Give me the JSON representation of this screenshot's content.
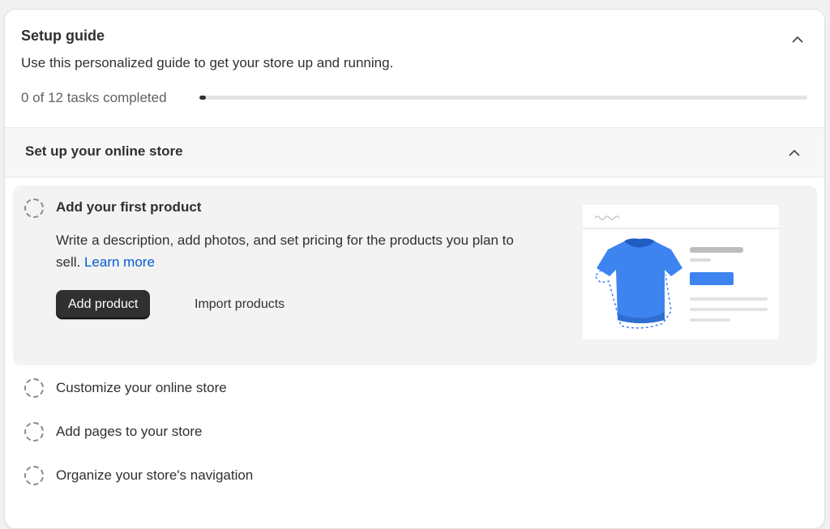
{
  "setup_guide": {
    "title": "Setup guide",
    "subtitle": "Use this personalized guide to get your store up and running.",
    "progress_text": "0 of 12 tasks completed",
    "progress_fraction": 0,
    "collapse_icon": "chevron-up-icon"
  },
  "section": {
    "title": "Set up your online store",
    "chevron_icon": "chevron-up-icon"
  },
  "active_task": {
    "title": "Add your first product",
    "description": "Write a description, add photos, and set pricing for the products you plan to sell.",
    "learn_more": "Learn more",
    "primary_button": "Add product",
    "secondary_button": "Import products",
    "illustration": "t-shirt-product-illustration",
    "status_icon": "dashed-circle-icon"
  },
  "tasks": [
    {
      "label": "Customize your online store",
      "status_icon": "dashed-circle-icon"
    },
    {
      "label": "Add pages to your store",
      "status_icon": "dashed-circle-icon"
    },
    {
      "label": "Organize your store's navigation",
      "status_icon": "dashed-circle-icon"
    }
  ],
  "colors": {
    "primary_button": "#303030",
    "link": "#005bd3",
    "shirt": "#3d84f0",
    "accent_bar": "#3d84f0"
  }
}
